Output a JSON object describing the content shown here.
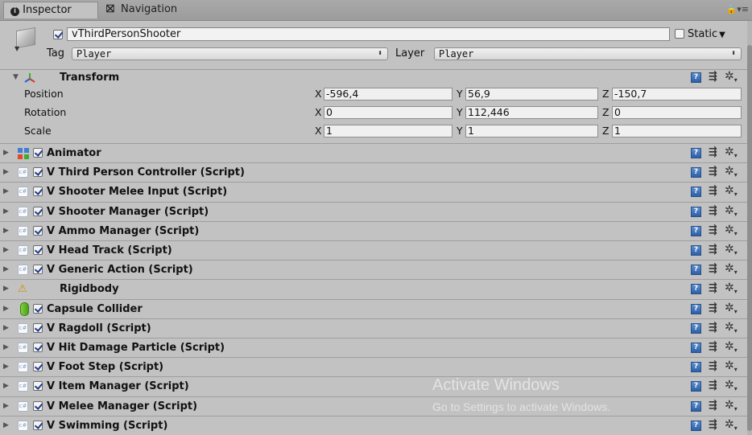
{
  "tabs": {
    "inspector": "Inspector",
    "navigation": "Navigation"
  },
  "object": {
    "active": true,
    "name": "vThirdPersonShooter",
    "static_label": "Static",
    "static_checked": false,
    "tag_label": "Tag",
    "tag_value": "Player",
    "layer_label": "Layer",
    "layer_value": "Player"
  },
  "transform": {
    "title": "Transform",
    "rows": [
      {
        "label": "Position",
        "x": "-596,4",
        "y": "56,9",
        "z": "-150,7"
      },
      {
        "label": "Rotation",
        "x": "0",
        "y": "112,446",
        "z": "0"
      },
      {
        "label": "Scale",
        "x": "1",
        "y": "1",
        "z": "1"
      }
    ],
    "axis": {
      "x": "X",
      "y": "Y",
      "z": "Z"
    }
  },
  "components": [
    {
      "title": "Animator",
      "icon": "animator-icon",
      "checkbox": true
    },
    {
      "title": "V Third Person Controller (Script)",
      "icon": "csharp-script-icon",
      "checkbox": true
    },
    {
      "title": "V Shooter Melee Input (Script)",
      "icon": "csharp-script-icon",
      "checkbox": true
    },
    {
      "title": "V Shooter Manager (Script)",
      "icon": "csharp-script-icon",
      "checkbox": true
    },
    {
      "title": "V Ammo Manager (Script)",
      "icon": "csharp-script-icon",
      "checkbox": true
    },
    {
      "title": "V Head Track (Script)",
      "icon": "csharp-script-icon",
      "checkbox": true
    },
    {
      "title": "V Generic Action (Script)",
      "icon": "csharp-script-icon",
      "checkbox": true
    },
    {
      "title": "Rigidbody",
      "icon": "rigidbody-icon",
      "checkbox": false
    },
    {
      "title": "Capsule Collider",
      "icon": "capsule-collider-icon",
      "checkbox": true
    },
    {
      "title": "V Ragdoll (Script)",
      "icon": "csharp-script-icon",
      "checkbox": true
    },
    {
      "title": "V Hit Damage Particle (Script)",
      "icon": "csharp-script-icon",
      "checkbox": true
    },
    {
      "title": "V Foot Step (Script)",
      "icon": "csharp-script-icon",
      "checkbox": true
    },
    {
      "title": "V Item Manager (Script)",
      "icon": "csharp-script-icon",
      "checkbox": true
    },
    {
      "title": "V Melee Manager (Script)",
      "icon": "csharp-script-icon",
      "checkbox": true
    },
    {
      "title": "V Swimming (Script)",
      "icon": "csharp-script-icon",
      "checkbox": true
    }
  ],
  "watermark": {
    "line1": "Activate Windows",
    "line2": "Go to Settings to activate Windows."
  }
}
